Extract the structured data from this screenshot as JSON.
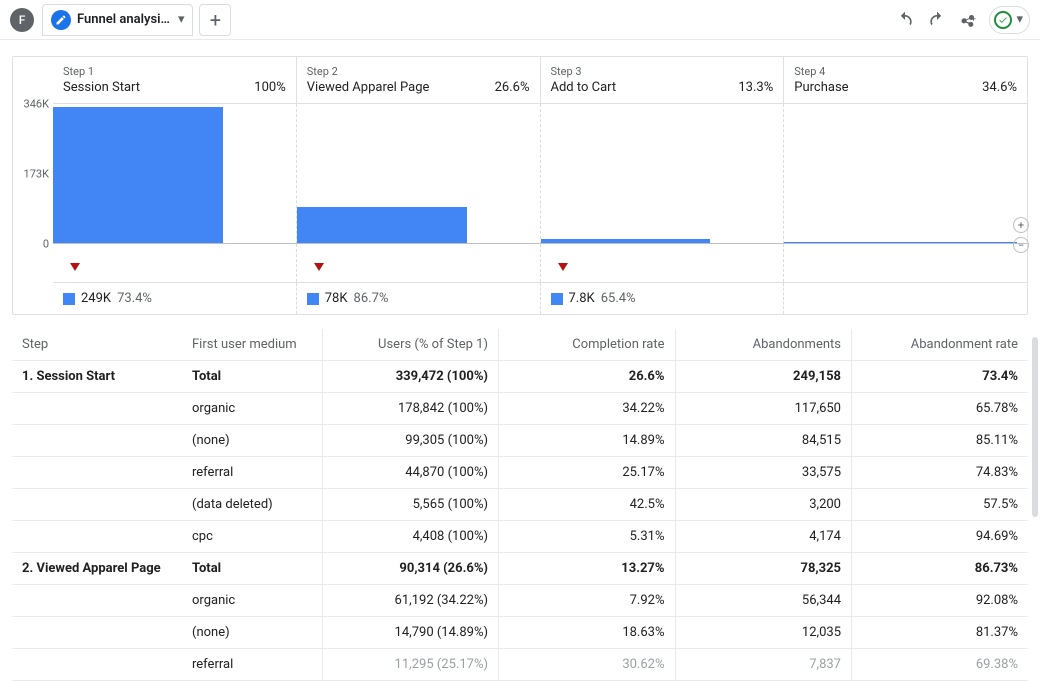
{
  "toolbar": {
    "avatar": "F",
    "tab_label": "Funnel analysi…"
  },
  "chart_data": {
    "type": "bar",
    "title": "",
    "ylim": [
      0,
      346000
    ],
    "yticks": [
      {
        "value": 346000,
        "label": "346K",
        "pos": 0
      },
      {
        "value": 173000,
        "label": "173K",
        "pos": 0.5
      },
      {
        "value": 0,
        "label": "0",
        "pos": 1
      }
    ],
    "steps": [
      {
        "step_label": "Step 1",
        "name": "Session Start",
        "pct": "100%",
        "bar_users": 339472,
        "bar_width_pct": 70,
        "drop_value": "249K",
        "drop_pct": "73.4%"
      },
      {
        "step_label": "Step 2",
        "name": "Viewed Apparel Page",
        "pct": "26.6%",
        "bar_users": 90314,
        "bar_width_pct": 70,
        "drop_value": "78K",
        "drop_pct": "86.7%"
      },
      {
        "step_label": "Step 3",
        "name": "Add to Cart",
        "pct": "13.3%",
        "bar_users": 11989,
        "bar_width_pct": 70,
        "drop_value": "7.8K",
        "drop_pct": "65.4%"
      },
      {
        "step_label": "Step 4",
        "name": "Purchase",
        "pct": "34.6%",
        "bar_users": 4152,
        "bar_width_pct": 96,
        "drop_value": "",
        "drop_pct": ""
      }
    ]
  },
  "table": {
    "headers": {
      "step": "Step",
      "medium": "First user medium",
      "users": "Users (% of Step 1)",
      "completion": "Completion rate",
      "abandon": "Abandonments",
      "abandon_rate": "Abandonment rate"
    },
    "rows": [
      {
        "step": "1. Session Start",
        "medium": "Total",
        "users": "339,472 (100%)",
        "completion": "26.6%",
        "abandon": "249,158",
        "abandon_rate": "73.4%",
        "total": true
      },
      {
        "step": "",
        "medium": "organic",
        "users": "178,842 (100%)",
        "completion": "34.22%",
        "abandon": "117,650",
        "abandon_rate": "65.78%"
      },
      {
        "step": "",
        "medium": "(none)",
        "users": "99,305 (100%)",
        "completion": "14.89%",
        "abandon": "84,515",
        "abandon_rate": "85.11%"
      },
      {
        "step": "",
        "medium": "referral",
        "users": "44,870 (100%)",
        "completion": "25.17%",
        "abandon": "33,575",
        "abandon_rate": "74.83%"
      },
      {
        "step": "",
        "medium": "(data deleted)",
        "users": "5,565 (100%)",
        "completion": "42.5%",
        "abandon": "3,200",
        "abandon_rate": "57.5%"
      },
      {
        "step": "",
        "medium": "cpc",
        "users": "4,408 (100%)",
        "completion": "5.31%",
        "abandon": "4,174",
        "abandon_rate": "94.69%"
      },
      {
        "step": "2. Viewed Apparel Page",
        "medium": "Total",
        "users": "90,314 (26.6%)",
        "completion": "13.27%",
        "abandon": "78,325",
        "abandon_rate": "86.73%",
        "total": true
      },
      {
        "step": "",
        "medium": "organic",
        "users": "61,192 (34.22%)",
        "completion": "7.92%",
        "abandon": "56,344",
        "abandon_rate": "92.08%"
      },
      {
        "step": "",
        "medium": "(none)",
        "users": "14,790 (14.89%)",
        "completion": "18.63%",
        "abandon": "12,035",
        "abandon_rate": "81.37%"
      },
      {
        "step": "",
        "medium": "referral",
        "users": "11,295 (25.17%)",
        "completion": "30.62%",
        "abandon": "7,837",
        "abandon_rate": "69.38%",
        "fade": true
      }
    ]
  }
}
